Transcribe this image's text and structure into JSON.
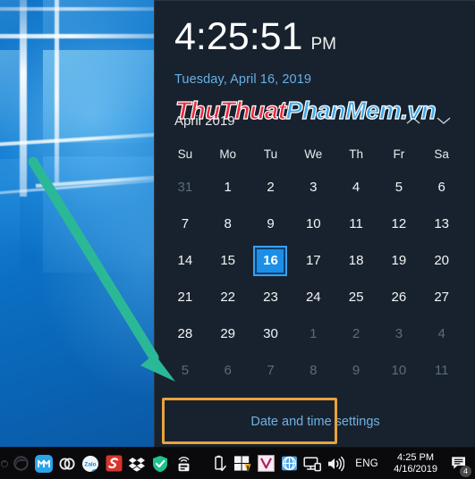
{
  "watermark": {
    "part_red": "ThuThuat",
    "part_blue": "PhanMem.vn",
    "color_red": "#e8283c",
    "color_blue": "#3ca8e8"
  },
  "flyout": {
    "time": "4:25:51",
    "ampm": "PM",
    "date": "Tuesday, April 16, 2019",
    "month_label": "April 2019",
    "prev_icon": "chevron-up-icon",
    "next_icon": "chevron-down-icon",
    "day_headers": [
      "Su",
      "Mo",
      "Tu",
      "We",
      "Th",
      "Fr",
      "Sa"
    ],
    "weeks": [
      [
        {
          "d": "31",
          "muted": true
        },
        {
          "d": "1",
          "muted": false
        },
        {
          "d": "2",
          "muted": false
        },
        {
          "d": "3",
          "muted": false
        },
        {
          "d": "4",
          "muted": false
        },
        {
          "d": "5",
          "muted": false
        },
        {
          "d": "6",
          "muted": false
        }
      ],
      [
        {
          "d": "7",
          "muted": false
        },
        {
          "d": "8",
          "muted": false
        },
        {
          "d": "9",
          "muted": false
        },
        {
          "d": "10",
          "muted": false
        },
        {
          "d": "11",
          "muted": false
        },
        {
          "d": "12",
          "muted": false
        },
        {
          "d": "13",
          "muted": false
        }
      ],
      [
        {
          "d": "14",
          "muted": false
        },
        {
          "d": "15",
          "muted": false
        },
        {
          "d": "16",
          "muted": false,
          "today": true
        },
        {
          "d": "17",
          "muted": false
        },
        {
          "d": "18",
          "muted": false
        },
        {
          "d": "19",
          "muted": false
        },
        {
          "d": "20",
          "muted": false
        }
      ],
      [
        {
          "d": "21",
          "muted": false
        },
        {
          "d": "22",
          "muted": false
        },
        {
          "d": "23",
          "muted": false
        },
        {
          "d": "24",
          "muted": false
        },
        {
          "d": "25",
          "muted": false
        },
        {
          "d": "26",
          "muted": false
        },
        {
          "d": "27",
          "muted": false
        }
      ],
      [
        {
          "d": "28",
          "muted": false
        },
        {
          "d": "29",
          "muted": false
        },
        {
          "d": "30",
          "muted": false
        },
        {
          "d": "1",
          "muted": true
        },
        {
          "d": "2",
          "muted": true
        },
        {
          "d": "3",
          "muted": true
        },
        {
          "d": "4",
          "muted": true
        }
      ],
      [
        {
          "d": "5",
          "muted": true
        },
        {
          "d": "6",
          "muted": true
        },
        {
          "d": "7",
          "muted": true
        },
        {
          "d": "8",
          "muted": true
        },
        {
          "d": "9",
          "muted": true
        },
        {
          "d": "10",
          "muted": true
        },
        {
          "d": "11",
          "muted": true
        }
      ]
    ],
    "settings_link": "Date and time settings",
    "selected_day": "16",
    "accent_color": "#1b8fe8",
    "link_color": "#6fb2e4",
    "panel_bg": "#18222e"
  },
  "annotations": {
    "highlight_box_color": "#e8a33d",
    "arrow_color": "#2bb897"
  },
  "taskbar": {
    "left_icons": [
      {
        "name": "edge-icon-partial",
        "label": "e"
      },
      {
        "name": "edge-icon",
        "label": "e"
      },
      {
        "name": "mega-icon",
        "label": "M"
      },
      {
        "name": "link-icon",
        "label": "link"
      },
      {
        "name": "zalo-icon",
        "label": "Zalo"
      },
      {
        "name": "snagit-icon",
        "label": "S"
      },
      {
        "name": "dropbox-icon",
        "label": "dropbox"
      },
      {
        "name": "shield-check-icon",
        "label": "shield"
      },
      {
        "name": "printer-icon",
        "label": "printer"
      }
    ],
    "tray_icons": [
      {
        "name": "usb-eject-icon",
        "label": "usb"
      },
      {
        "name": "windows-defender-warning-icon",
        "label": "defender"
      },
      {
        "name": "vietkey-icon",
        "label": "V"
      },
      {
        "name": "network-icon",
        "label": "network"
      },
      {
        "name": "display-icon",
        "label": "display"
      },
      {
        "name": "volume-icon",
        "label": "volume"
      }
    ],
    "language": "ENG",
    "clock_time": "4:25 PM",
    "clock_date": "4/16/2019",
    "notification_icon": "notification-icon",
    "notification_count": "4"
  }
}
